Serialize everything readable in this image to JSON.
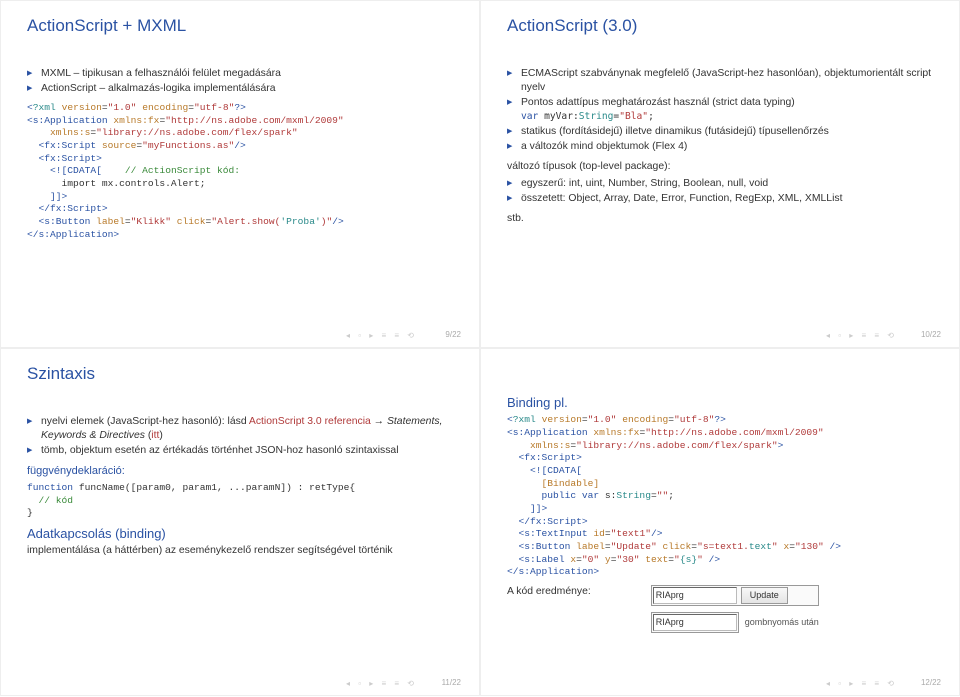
{
  "slides": [
    {
      "title": "ActionScript + MXML",
      "bullets1": [
        "MXML – tipikusan a felhasználói felület megadására",
        "ActionScript – alkalmazás-logika implementálására"
      ],
      "code1": "<?xml version=\"1.0\" encoding=\"utf-8\"?>\n<s:Application xmlns:fx=\"http://ns.adobe.com/mxml/2009\"\n    xmlns:s=\"library://ns.adobe.com/flex/spark\"\n  <fx:Script source=\"myFunctions.as\"/>\n  <fx:Script>\n    <![CDATA[    // ActionScript kód:\n      import mx.controls.Alert;\n    ]]>\n  </fx:Script>\n  <s:Button label=\"Klikk\" click=\"Alert.show('Proba')\"/>\n</s:Application>",
      "page": "9/22"
    },
    {
      "title": "ActionScript (3.0)",
      "bullets1": [
        "ECMAScript szabványnak megfelelő (JavaScript-hez hasonlóan), objektumorientált script nyelv",
        "Pontos adattípus meghatározást használ (strict data typing)",
        "statikus (fordításidejű) illetve dinamikus (futásidejű) típusellenőrzés",
        "a változók mind objektumok (Flex 4)"
      ],
      "inline_code": "var myVar:String=\"Bla\";",
      "sub1": "változó típusok (top-level package):",
      "bullets2": [
        "egyszerű: int, uint, Number, String, Boolean, null, void",
        "összetett: Object, Array, Date, Error, Function, RegExp, XML, XMLList"
      ],
      "tail": "stb.",
      "page": "10/22"
    },
    {
      "title": "Szintaxis",
      "bullets1": [
        "nyelvi elemek (JavaScript-hez hasonló): lásd ActionScript 3.0 referencia → Statements, Keywords & Directives (itt)",
        "tömb, objektum esetén az értékadás történhet JSON-hoz hasonló szintaxissal"
      ],
      "sub1": "függvénydeklaráció:",
      "code1": "function funcName([param0, param1, ...paramN]) : retType{\n  // kód\n}",
      "sub2": "Adatkapcsolás (binding)",
      "body2": "implementálása (a háttérben) az eseménykezelő rendszer segítségével történik",
      "page": "11/22"
    },
    {
      "title": "",
      "sub1": "Binding pl.",
      "code1": "<?xml version=\"1.0\" encoding=\"utf-8\"?>\n<s:Application xmlns:fx=\"http://ns.adobe.com/mxml/2009\"\n    xmlns:s=\"library://ns.adobe.com/flex/spark\">\n  <fx:Script>\n    <![CDATA[\n      [Bindable]\n      public var s:String=\"\";\n    ]]>\n  </fx:Script>\n  <s:TextInput id=\"text1\"/>\n  <s:Button label=\"Update\" click=\"s=text1.text\" x=\"130\" />\n  <s:Label x=\"0\" y=\"30\" text=\"{s}\" />\n</s:Application>",
      "result_label": "A kód eredménye:",
      "inp1": "RIAprg",
      "btn1": "Update",
      "inp2": "RIAprg",
      "caption2": "gombnyomás után",
      "page": "12/22"
    }
  ]
}
